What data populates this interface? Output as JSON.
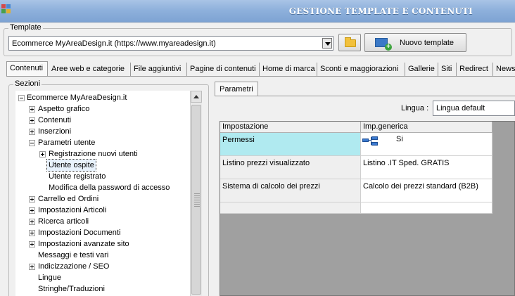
{
  "window": {
    "title": "GESTIONE TEMPLATE E CONTENUTI",
    "app_icon": "grid-app-icon"
  },
  "template": {
    "group_label": "Template",
    "selected": "Ecommerce MyAreaDesign.it (https://www.myareadesign.it)",
    "folder_icon": "folder-icon",
    "new_button_label": "Nuovo template",
    "new_icon": "new-template-icon"
  },
  "tabs": [
    {
      "label": "Contenuti",
      "active": true
    },
    {
      "label": "Aree web e categorie"
    },
    {
      "label": "File aggiuntivi"
    },
    {
      "label": "Pagine di contenuti"
    },
    {
      "label": "Home di marca"
    },
    {
      "label": "Sconti e maggiorazioni"
    },
    {
      "label": "Gallerie"
    },
    {
      "label": "Siti"
    },
    {
      "label": "Redirect"
    },
    {
      "label": "News"
    }
  ],
  "sezioni": {
    "group_label": "Sezioni",
    "tree": [
      {
        "label": "Ecommerce MyAreaDesign.it",
        "level": 0,
        "expander": "minus"
      },
      {
        "label": "Aspetto grafico",
        "level": 1,
        "expander": "plus"
      },
      {
        "label": "Contenuti",
        "level": 1,
        "expander": "plus"
      },
      {
        "label": "Inserzioni",
        "level": 1,
        "expander": "plus"
      },
      {
        "label": "Parametri utente",
        "level": 1,
        "expander": "minus"
      },
      {
        "label": "Registrazione nuovi utenti",
        "level": 2,
        "expander": "plus"
      },
      {
        "label": "Utente ospite",
        "level": 2,
        "expander": "none",
        "selected": true
      },
      {
        "label": "Utente registrato",
        "level": 2,
        "expander": "none"
      },
      {
        "label": "Modifica della password di accesso",
        "level": 2,
        "expander": "none"
      },
      {
        "label": "Carrello ed Ordini",
        "level": 1,
        "expander": "plus"
      },
      {
        "label": "Impostazioni Articoli",
        "level": 1,
        "expander": "plus"
      },
      {
        "label": "Ricerca articoli",
        "level": 1,
        "expander": "plus"
      },
      {
        "label": "Impostazioni Documenti",
        "level": 1,
        "expander": "plus"
      },
      {
        "label": "Impostazioni avanzate sito",
        "level": 1,
        "expander": "plus"
      },
      {
        "label": "Messaggi e testi vari",
        "level": 1,
        "expander": "none"
      },
      {
        "label": "Indicizzazione / SEO",
        "level": 1,
        "expander": "plus"
      },
      {
        "label": "Lingue",
        "level": 1,
        "expander": "none"
      },
      {
        "label": "Stringhe/Traduzioni",
        "level": 1,
        "expander": "none"
      }
    ]
  },
  "parametri": {
    "tab_label": "Parametri",
    "lingua_label": "Lingua :",
    "lingua_value": "Lingua default",
    "columns": [
      "Impostazione",
      "Imp.generica"
    ],
    "rows": [
      {
        "setting": "Permessi",
        "value": "Si",
        "icon": "permissions-hierarchy-icon",
        "highlight_color": "#b0eaf0"
      },
      {
        "setting": "Listino prezzi visualizzato",
        "value": "Listino .IT Sped. GRATIS"
      },
      {
        "setting": "Sistema di calcolo dei prezzi",
        "value": "Calcolo dei prezzi standard (B2B)"
      },
      {
        "setting": "",
        "value": ""
      }
    ]
  }
}
